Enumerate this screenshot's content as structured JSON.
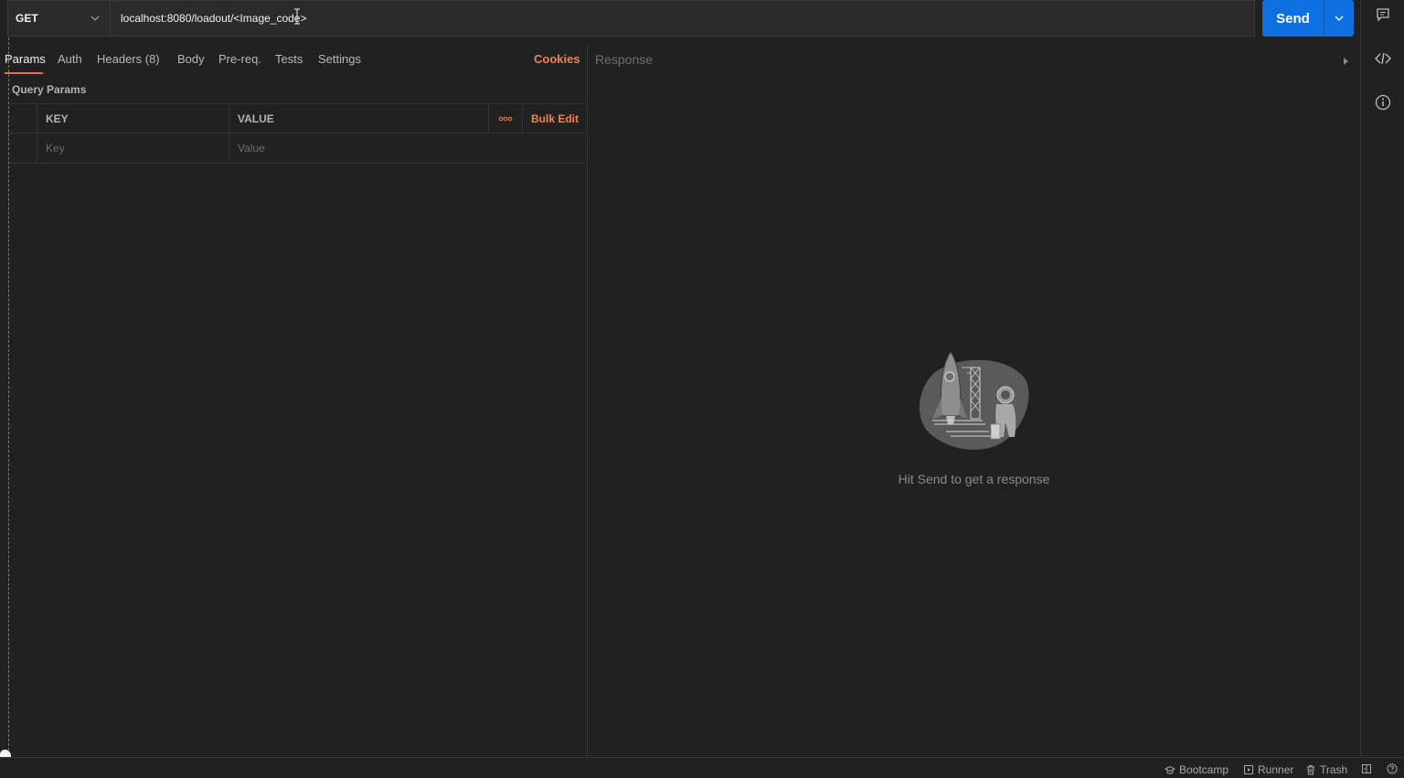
{
  "request": {
    "method": "GET",
    "url": "localhost:8080/loadout/<Image_code>",
    "send_label": "Send"
  },
  "tabs": {
    "params": "Params",
    "auth": "Auth",
    "headers": "Headers (8)",
    "body": "Body",
    "prereq": "Pre-req.",
    "tests": "Tests",
    "settings": "Settings",
    "cookies": "Cookies"
  },
  "query_params": {
    "title": "Query Params",
    "columns": {
      "key": "KEY",
      "value": "VALUE",
      "bulk_edit": "Bulk Edit"
    },
    "row": {
      "key_placeholder": "Key",
      "value_placeholder": "Value"
    }
  },
  "response": {
    "title": "Response",
    "empty_message": "Hit Send to get a response"
  },
  "statusbar": {
    "bootcamp": "Bootcamp",
    "runner": "Runner",
    "trash": "Trash"
  },
  "icons": {
    "method_dropdown": "chevron-down-icon",
    "send_dropdown": "chevron-down-icon",
    "comments": "comment-icon",
    "code": "code-icon",
    "info": "info-icon",
    "more": "more-dots-icon",
    "collapse": "caret-right-icon",
    "bootcamp": "graduation-cap-icon",
    "runner": "runner-icon",
    "trash": "trash-icon",
    "two_pane": "two-pane-icon",
    "help": "help-icon"
  },
  "colors": {
    "accent": "#f26b3a",
    "send_button": "#0d6fe0",
    "background": "#212121"
  }
}
